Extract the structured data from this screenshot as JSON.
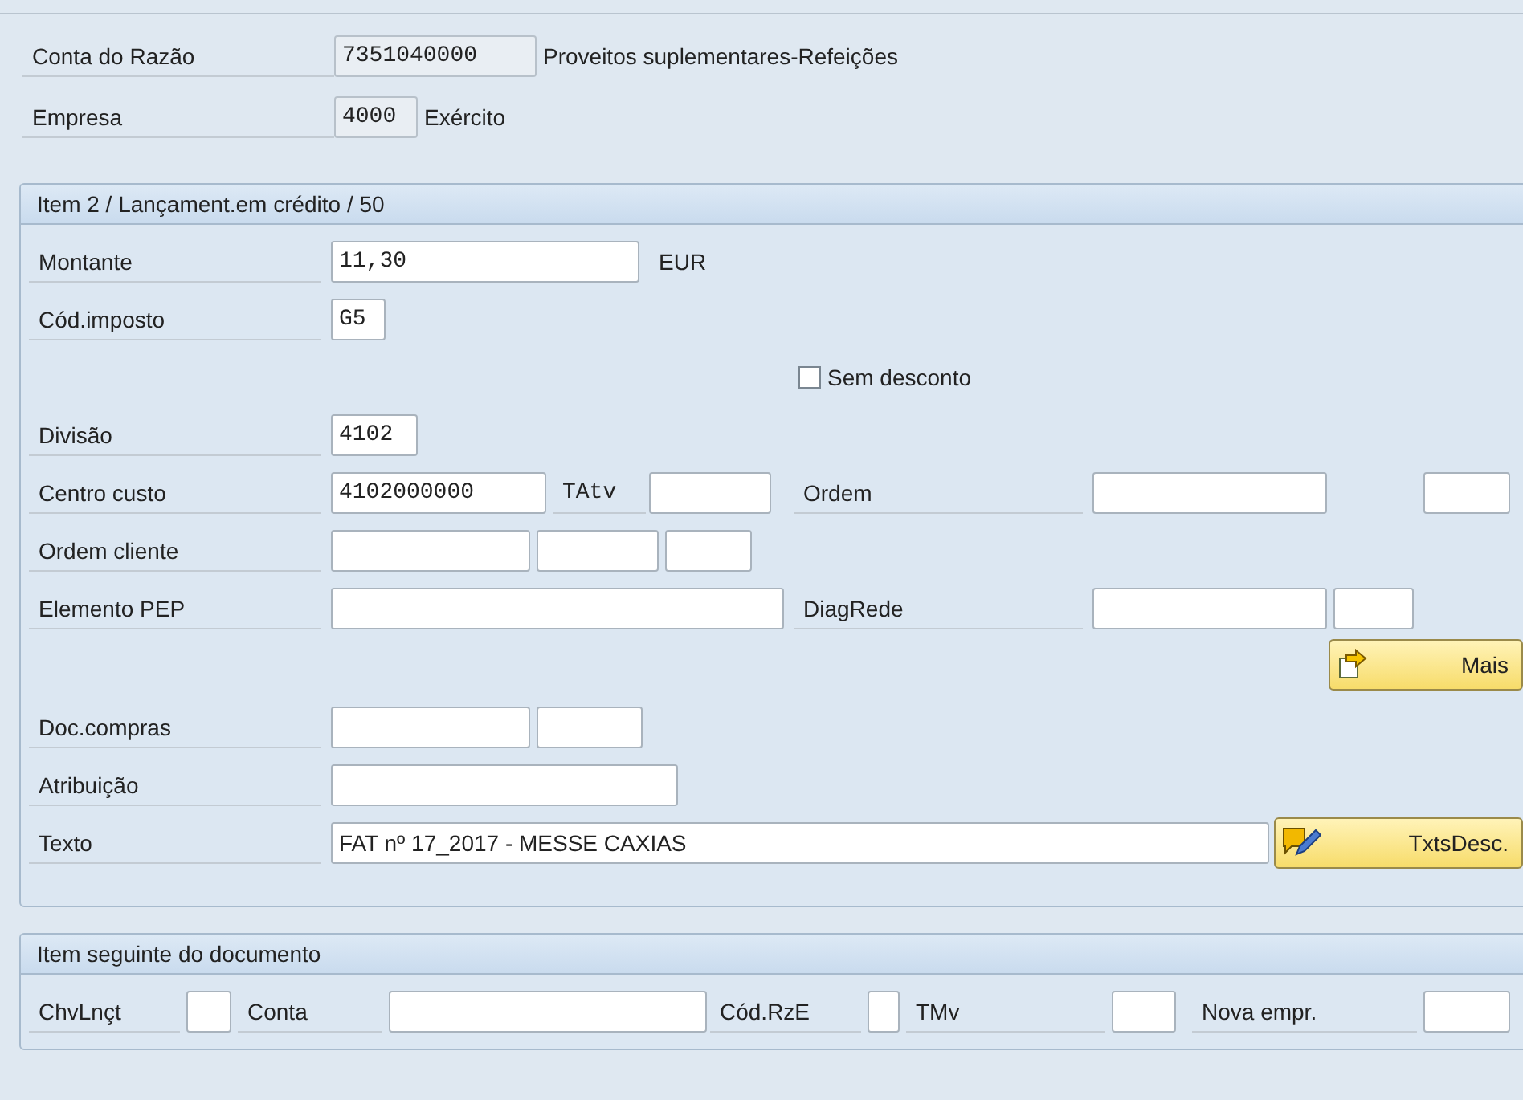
{
  "header": {
    "rows": [
      {
        "label": "Conta do Razão",
        "value": "7351040000",
        "readonly": true,
        "description": "Proveitos suplementares-Refeições"
      },
      {
        "label": "Empresa",
        "value": "4000",
        "readonly": true,
        "description": "Exército"
      }
    ]
  },
  "panels": [
    {
      "title": "Item 2 / Lançament.em crédito / 50",
      "rows": [
        {
          "kind": "fields",
          "items": [
            {
              "kind": "label",
              "text": "Montante"
            },
            {
              "kind": "field",
              "value": "11,30"
            },
            {
              "kind": "text",
              "text": "EUR"
            }
          ]
        },
        {
          "kind": "fields",
          "items": [
            {
              "kind": "label",
              "text": "Cód.imposto"
            },
            {
              "kind": "field",
              "value": "G5"
            }
          ]
        },
        {
          "kind": "checkbox",
          "text": "Sem desconto",
          "checked": false
        },
        {
          "kind": "fields",
          "items": [
            {
              "kind": "label",
              "text": "Divisão"
            },
            {
              "kind": "field",
              "value": "4102"
            }
          ]
        },
        {
          "kind": "fields",
          "items": [
            {
              "kind": "label",
              "text": "Centro custo"
            },
            {
              "kind": "field",
              "value": "4102000000"
            },
            {
              "kind": "label",
              "text": "TAtv"
            },
            {
              "kind": "field"
            },
            {
              "kind": "label",
              "text": "Ordem"
            },
            {
              "kind": "field"
            },
            {
              "kind": "field"
            }
          ]
        },
        {
          "kind": "fields",
          "items": [
            {
              "kind": "label",
              "text": "Ordem cliente"
            },
            {
              "kind": "field"
            },
            {
              "kind": "field"
            },
            {
              "kind": "field"
            }
          ]
        },
        {
          "kind": "fields",
          "items": [
            {
              "kind": "label",
              "text": "Elemento PEP"
            },
            {
              "kind": "field"
            },
            {
              "kind": "label",
              "text": "DiagRede"
            },
            {
              "kind": "field"
            },
            {
              "kind": "field"
            }
          ]
        },
        {
          "kind": "button",
          "text": "Mais"
        },
        {
          "kind": "fields",
          "items": [
            {
              "kind": "label",
              "text": "Doc.compras"
            },
            {
              "kind": "field"
            },
            {
              "kind": "field"
            }
          ]
        },
        {
          "kind": "fields",
          "items": [
            {
              "kind": "label",
              "text": "Atribuição"
            },
            {
              "kind": "field"
            }
          ]
        },
        {
          "kind": "fields",
          "items": [
            {
              "kind": "label",
              "text": "Texto"
            },
            {
              "kind": "field",
              "value": "FAT nº 17_2017 - MESSE CAXIAS"
            },
            {
              "kind": "button",
              "text": "TxtsDesc."
            }
          ]
        }
      ]
    },
    {
      "title": "Item seguinte do documento",
      "rows": [
        {
          "kind": "fields",
          "items": [
            {
              "kind": "label",
              "text": "ChvLnçt"
            },
            {
              "kind": "field"
            },
            {
              "kind": "label",
              "text": "Conta"
            },
            {
              "kind": "field"
            },
            {
              "kind": "label",
              "text": "Cód.RzE"
            },
            {
              "kind": "field"
            },
            {
              "kind": "label",
              "text": "TMv"
            },
            {
              "kind": "field"
            },
            {
              "kind": "label",
              "text": "Nova empr."
            },
            {
              "kind": "field"
            }
          ]
        }
      ]
    }
  ]
}
